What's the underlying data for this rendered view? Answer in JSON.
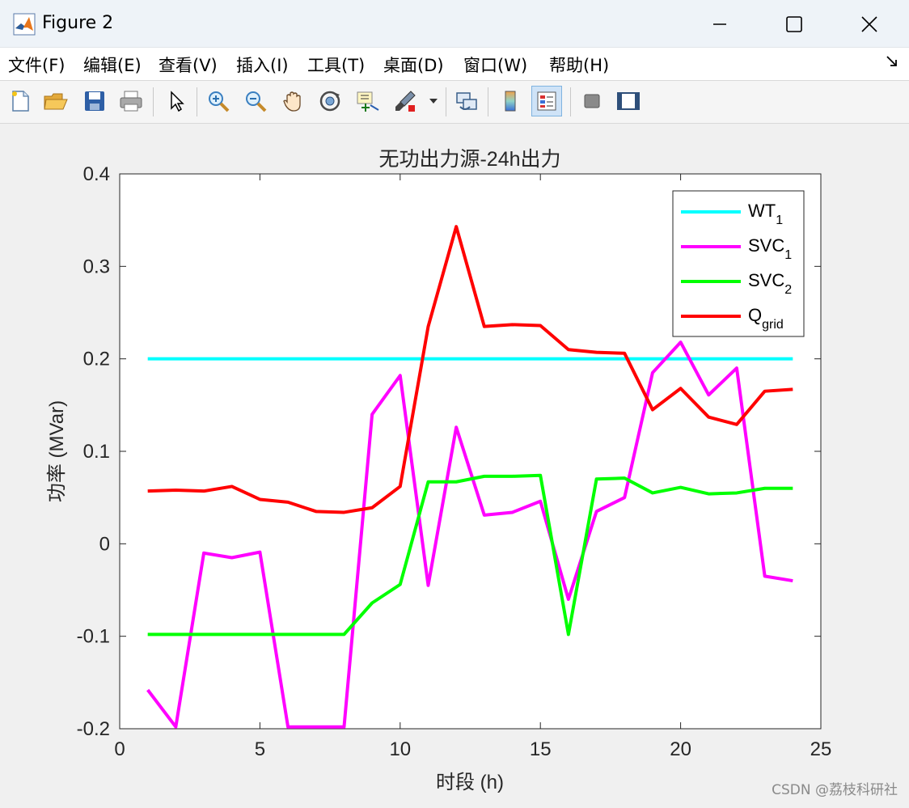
{
  "window": {
    "title": "Figure 2"
  },
  "menu": [
    "文件(F)",
    "编辑(E)",
    "查看(V)",
    "插入(I)",
    "工具(T)",
    "桌面(D)",
    "窗口(W)",
    "帮助(H)"
  ],
  "toolbar": [
    "new-file-icon",
    "open-folder-icon",
    "save-icon",
    "print-icon",
    "pointer-icon",
    "zoom-in-icon",
    "zoom-out-icon",
    "pan-icon",
    "rotate-3d-icon",
    "data-cursor-icon",
    "brush-icon",
    "link-plot-icon",
    "colorbar-icon",
    "legend-icon",
    "hide-plot-tools-icon",
    "show-plot-tools-icon"
  ],
  "watermark": "CSDN @荔枝科研社",
  "chart_data": {
    "type": "line",
    "title": "无功出力源-24h出力",
    "xlabel": "时段 (h)",
    "ylabel": "功率 (MVar)",
    "xlim": [
      0,
      25
    ],
    "ylim": [
      -0.2,
      0.4
    ],
    "xticks": [
      0,
      5,
      10,
      15,
      20,
      25
    ],
    "yticks": [
      -0.2,
      -0.1,
      0,
      0.1,
      0.2,
      0.3,
      0.4
    ],
    "x": [
      1,
      2,
      3,
      4,
      5,
      6,
      7,
      8,
      9,
      10,
      11,
      12,
      13,
      14,
      15,
      16,
      17,
      18,
      19,
      20,
      21,
      22,
      23,
      24
    ],
    "legend_position": "top-right",
    "grid": false,
    "series": [
      {
        "name": "WT",
        "sub": "1",
        "color": "#00ffff",
        "values": [
          0.2,
          0.2,
          0.2,
          0.2,
          0.2,
          0.2,
          0.2,
          0.2,
          0.2,
          0.2,
          0.2,
          0.2,
          0.2,
          0.2,
          0.2,
          0.2,
          0.2,
          0.2,
          0.2,
          0.2,
          0.2,
          0.2,
          0.2,
          0.2
        ]
      },
      {
        "name": "SVC",
        "sub": "1",
        "color": "#ff00ff",
        "values": [
          -0.158,
          -0.198,
          -0.01,
          -0.015,
          -0.009,
          -0.198,
          -0.198,
          -0.198,
          0.14,
          0.182,
          -0.045,
          0.126,
          0.031,
          0.034,
          0.046,
          -0.06,
          0.035,
          0.05,
          0.185,
          0.218,
          0.161,
          0.19,
          -0.035,
          -0.04
        ]
      },
      {
        "name": "SVC",
        "sub": "2",
        "color": "#00ff00",
        "values": [
          -0.098,
          -0.098,
          -0.098,
          -0.098,
          -0.098,
          -0.098,
          -0.098,
          -0.098,
          -0.064,
          -0.044,
          0.067,
          0.067,
          0.073,
          0.073,
          0.074,
          -0.098,
          0.07,
          0.071,
          0.055,
          0.061,
          0.054,
          0.055,
          0.06,
          0.06
        ]
      },
      {
        "name": "Q",
        "sub": "grid",
        "color": "#ff0000",
        "values": [
          0.057,
          0.058,
          0.057,
          0.062,
          0.048,
          0.045,
          0.035,
          0.034,
          0.039,
          0.062,
          0.235,
          0.343,
          0.235,
          0.237,
          0.236,
          0.21,
          0.207,
          0.206,
          0.145,
          0.168,
          0.137,
          0.129,
          0.165,
          0.167
        ]
      }
    ]
  }
}
